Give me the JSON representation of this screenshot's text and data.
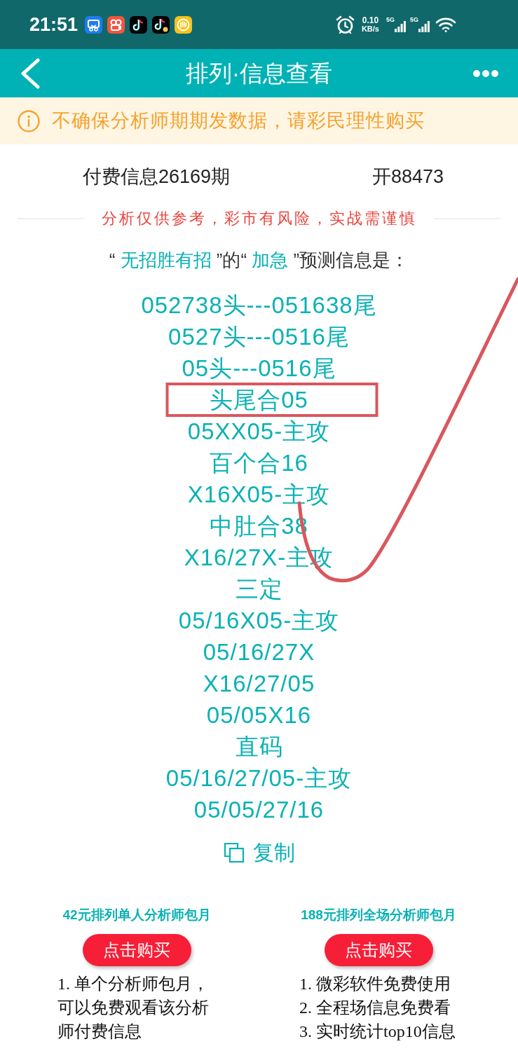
{
  "status_bar": {
    "time": "21:51",
    "net_speed": "0.10",
    "net_unit": "KB/s",
    "sims": [
      {
        "network": "5G"
      },
      {
        "network": "5G"
      }
    ]
  },
  "header": {
    "title": "排列·信息查看"
  },
  "notice": {
    "text": "不确保分析师期期发数据，请彩民理性购买"
  },
  "issue": {
    "label": "付费信息26169期",
    "result": "开88473"
  },
  "disclaimer": "分析仅供参考，彩市有风险，实战需谨慎",
  "heading": [
    {
      "kind": "plain",
      "text": "“ "
    },
    {
      "kind": "highlight",
      "text": "无招胜有招"
    },
    {
      "kind": "plain",
      "text": " ”的“ "
    },
    {
      "kind": "highlight",
      "text": "加急"
    },
    {
      "kind": "plain",
      "text": " ”预测信息是："
    }
  ],
  "predictions": [
    "052738头---051638尾",
    "0527头---0516尾",
    "05头---0516尾",
    "头尾合05",
    "05XX05-主攻",
    "百个合16",
    "X16X05-主攻",
    "中肚合38",
    "X16/27X-主攻",
    "三定",
    "05/16X05-主攻",
    "05/16/27X",
    "X16/27/05",
    "05/05X16",
    "直码",
    "05/16/27/05-主攻",
    "05/05/27/16"
  ],
  "copy_button": {
    "label": "复制"
  },
  "plans": [
    {
      "title": "42元排列单人分析师包月",
      "button": "点击购买",
      "features": [
        "1. 单个分析师包月，可以免费观看该分析师付费信息"
      ]
    },
    {
      "title": "188元排列全场分析师包月",
      "button": "点击购买",
      "features": [
        "1. 微彩软件免费使用",
        "2. 全程场信息免费看",
        "3. 实时统计top10信息"
      ]
    }
  ]
}
